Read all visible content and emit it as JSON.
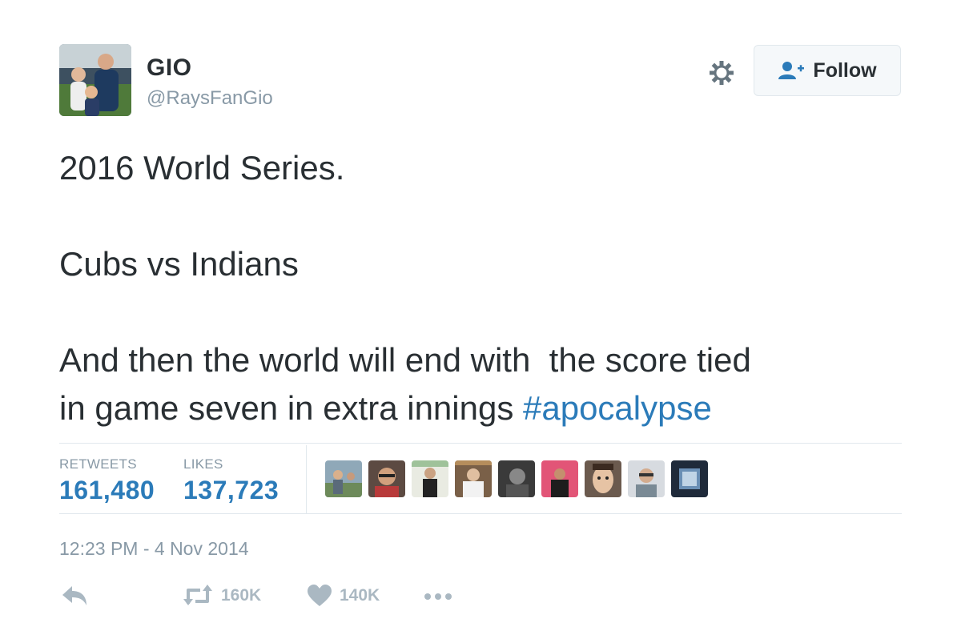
{
  "user": {
    "name": "GIO",
    "handle": "@RaysFanGio"
  },
  "header": {
    "follow_label": "Follow",
    "icons": [
      "gear-icon",
      "follow-person-icon"
    ]
  },
  "tweet": {
    "lines": [
      "2016 World Series.",
      "Cubs vs Indians",
      "And then the world will end with  the score tied",
      "in game seven in extra innings "
    ],
    "hashtag": "#apocalypse"
  },
  "stats": {
    "retweets_label": "RETWEETS",
    "retweets_value": "161,480",
    "likes_label": "LIKES",
    "likes_value": "137,723"
  },
  "likers_count": 9,
  "timestamp": "12:23 PM - 4 Nov 2014",
  "actions": {
    "retweet_count": "160K",
    "like_count": "140K",
    "icons": [
      "reply-icon",
      "retweet-icon",
      "heart-icon",
      "more-icon"
    ]
  },
  "colors": {
    "text": "#292f33",
    "muted": "#8899a6",
    "link": "#2b7bb9",
    "action": "#aab8c2",
    "border": "#e1e8ed"
  }
}
